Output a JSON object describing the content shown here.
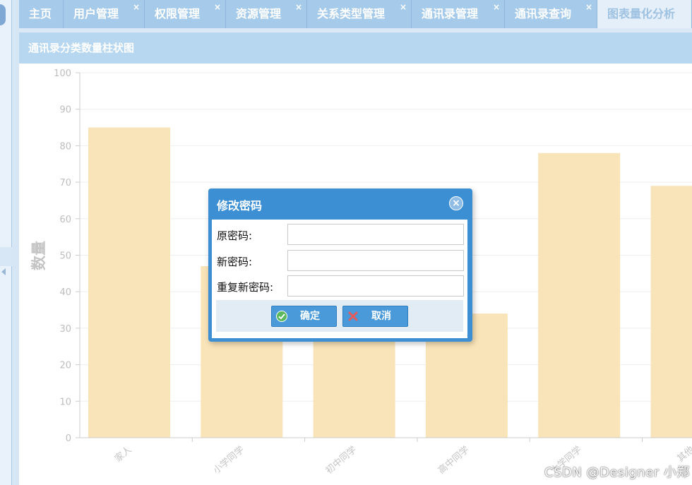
{
  "tabs": [
    {
      "label": "主页",
      "closable": false
    },
    {
      "label": "用户管理",
      "closable": true
    },
    {
      "label": "权限管理",
      "closable": true
    },
    {
      "label": "资源管理",
      "closable": true
    },
    {
      "label": "关系类型管理",
      "closable": true
    },
    {
      "label": "通讯录管理",
      "closable": true
    },
    {
      "label": "通讯录查询",
      "closable": true
    },
    {
      "label": "图表量化分析",
      "closable": false,
      "active": true
    }
  ],
  "tab_close_glyph": "×",
  "panel": {
    "title": "通讯录分类数量柱状图"
  },
  "chart_data": {
    "type": "bar",
    "title": "",
    "xlabel": "",
    "ylabel": "数量",
    "categories": [
      "家人",
      "小学同学",
      "初中同学",
      "高中同学",
      "大学同学",
      "其他"
    ],
    "values": [
      85,
      47,
      33,
      34,
      78,
      69
    ],
    "ylim": [
      0,
      100
    ],
    "yticks": [
      0,
      10,
      20,
      30,
      40,
      50,
      60,
      70,
      80,
      90,
      100
    ],
    "grid": true,
    "bar_color": "#f9e3b8",
    "gridline_color": "#eeeeee"
  },
  "dialog": {
    "title": "修改密码",
    "close_icon": "close-circle-icon",
    "fields": [
      {
        "label": "原密码:",
        "value": ""
      },
      {
        "label": "新密码:",
        "value": ""
      },
      {
        "label": "重复新密码:",
        "value": ""
      }
    ],
    "confirm_label": "确定",
    "cancel_label": "取消"
  },
  "watermark": "CSDN @Designer 小郑",
  "colors": {
    "accent": "#3d8fd4",
    "tab": "#a6cbea",
    "panel_header": "#b7d7f0"
  }
}
